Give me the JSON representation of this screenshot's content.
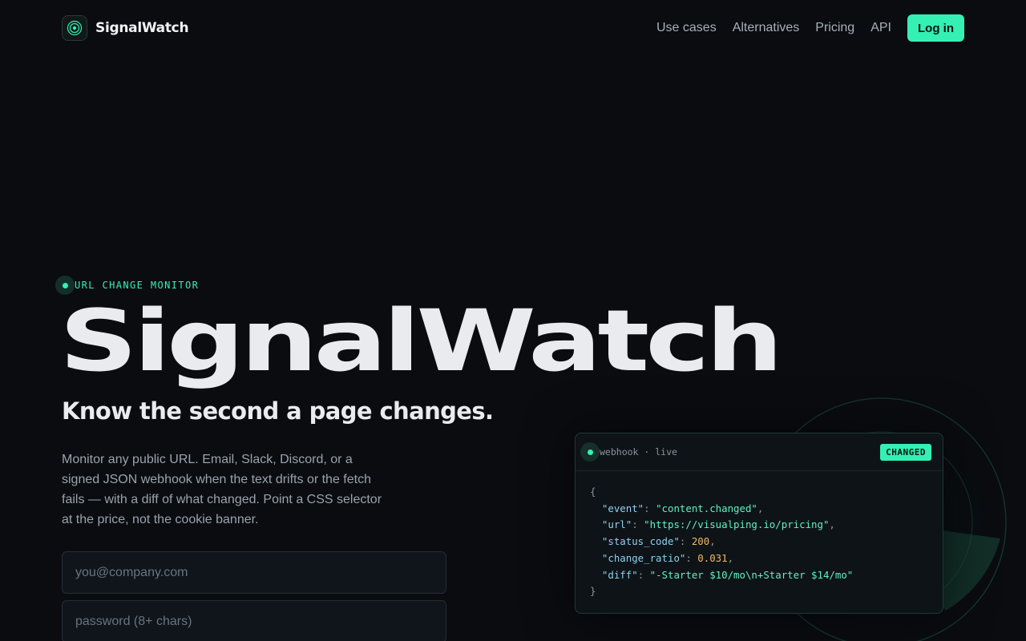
{
  "nav": {
    "brand": "SignalWatch",
    "links": [
      "Use cases",
      "Alternatives",
      "Pricing",
      "API"
    ],
    "login_label": "Log in"
  },
  "hero": {
    "eyebrow": "URL CHANGE MONITOR",
    "title": "SignalWatch",
    "subtitle": "Know the second a page changes.",
    "description": "Monitor any public URL. Email, Slack, Discord, or a signed JSON webhook when the text drifts or the fetch fails — with a diff of what changed. Point a CSS selector at the price, not the cookie banner.",
    "email_placeholder": "you@company.com",
    "password_placeholder": "password (8+ chars)"
  },
  "webhook": {
    "label": "webhook · live",
    "badge": "CHANGED",
    "open_brace": "{",
    "close_brace": "}",
    "fields": [
      {
        "key": "\"event\"",
        "value": "\"content.changed\"",
        "type": "s",
        "comma": ","
      },
      {
        "key": "\"url\"",
        "value": "\"https://visualping.io/pricing\"",
        "type": "s",
        "comma": ","
      },
      {
        "key": "\"status_code\"",
        "value": "200",
        "type": "n",
        "comma": ","
      },
      {
        "key": "\"change_ratio\"",
        "value": "0.031",
        "type": "n",
        "comma": ","
      },
      {
        "key": "\"diff\"",
        "value": "\"-Starter $10/mo\\n+Starter $14/mo\"",
        "type": "s",
        "comma": ""
      }
    ]
  },
  "colors": {
    "accent": "#34f0b2",
    "background": "#0a0c10"
  },
  "icons": {
    "brand": "radar-logo-icon",
    "live": "status-dot-icon"
  }
}
